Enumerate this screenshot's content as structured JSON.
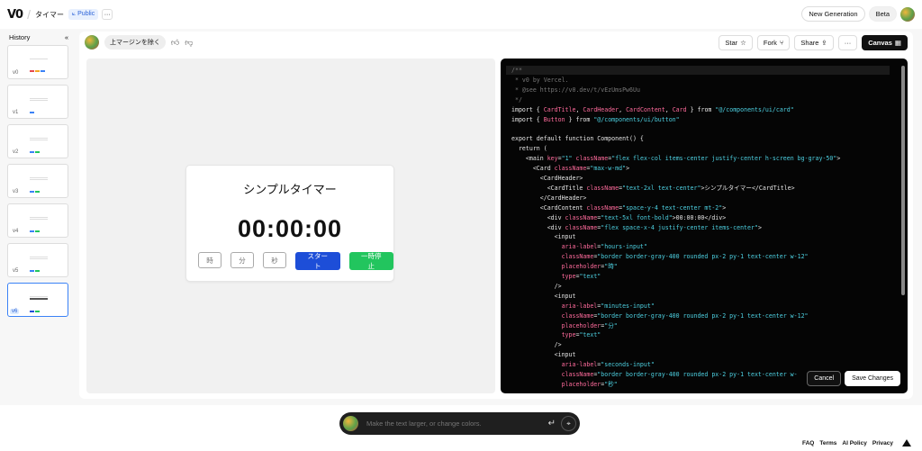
{
  "header": {
    "logo": "V0",
    "project_name": "タイマー",
    "visibility": "Public",
    "more": "···",
    "new_generation": "New Generation",
    "beta": "Beta"
  },
  "sidebar": {
    "title": "History",
    "collapse": "«",
    "versions": [
      "v0",
      "v1",
      "v2",
      "v3",
      "v4",
      "v5",
      "v6"
    ],
    "active": "v6"
  },
  "chat": {
    "prompt_chip": "上マージンを除く"
  },
  "toolbar": {
    "star": "Star",
    "fork": "Fork",
    "share": "Share",
    "more": "···",
    "canvas": "Canvas"
  },
  "preview": {
    "title": "シンプルタイマー",
    "time": "00:00:00",
    "hours_placeholder": "時",
    "minutes_placeholder": "分",
    "seconds_placeholder": "秒",
    "start": "スタート",
    "pause": "一時停止"
  },
  "code": {
    "cancel": "Cancel",
    "save": "Save Changes"
  },
  "prompt_bar": {
    "placeholder": "Make the text larger, or change colors."
  },
  "footer": {
    "links": [
      "FAQ",
      "Terms",
      "AI Policy",
      "Privacy"
    ]
  }
}
